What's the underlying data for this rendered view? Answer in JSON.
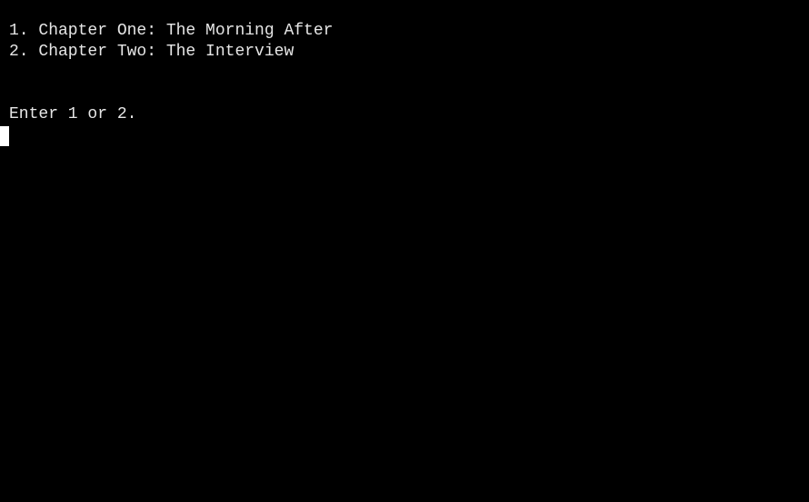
{
  "terminal": {
    "menu": [
      {
        "label": "1. Chapter One: The Morning After"
      },
      {
        "label": "2. Chapter Two: The Interview"
      }
    ],
    "prompt": "Enter 1 or 2.",
    "input_value": ""
  },
  "colors": {
    "background": "#000000",
    "text": "#e6e6e6",
    "cursor": "#ffffff"
  }
}
